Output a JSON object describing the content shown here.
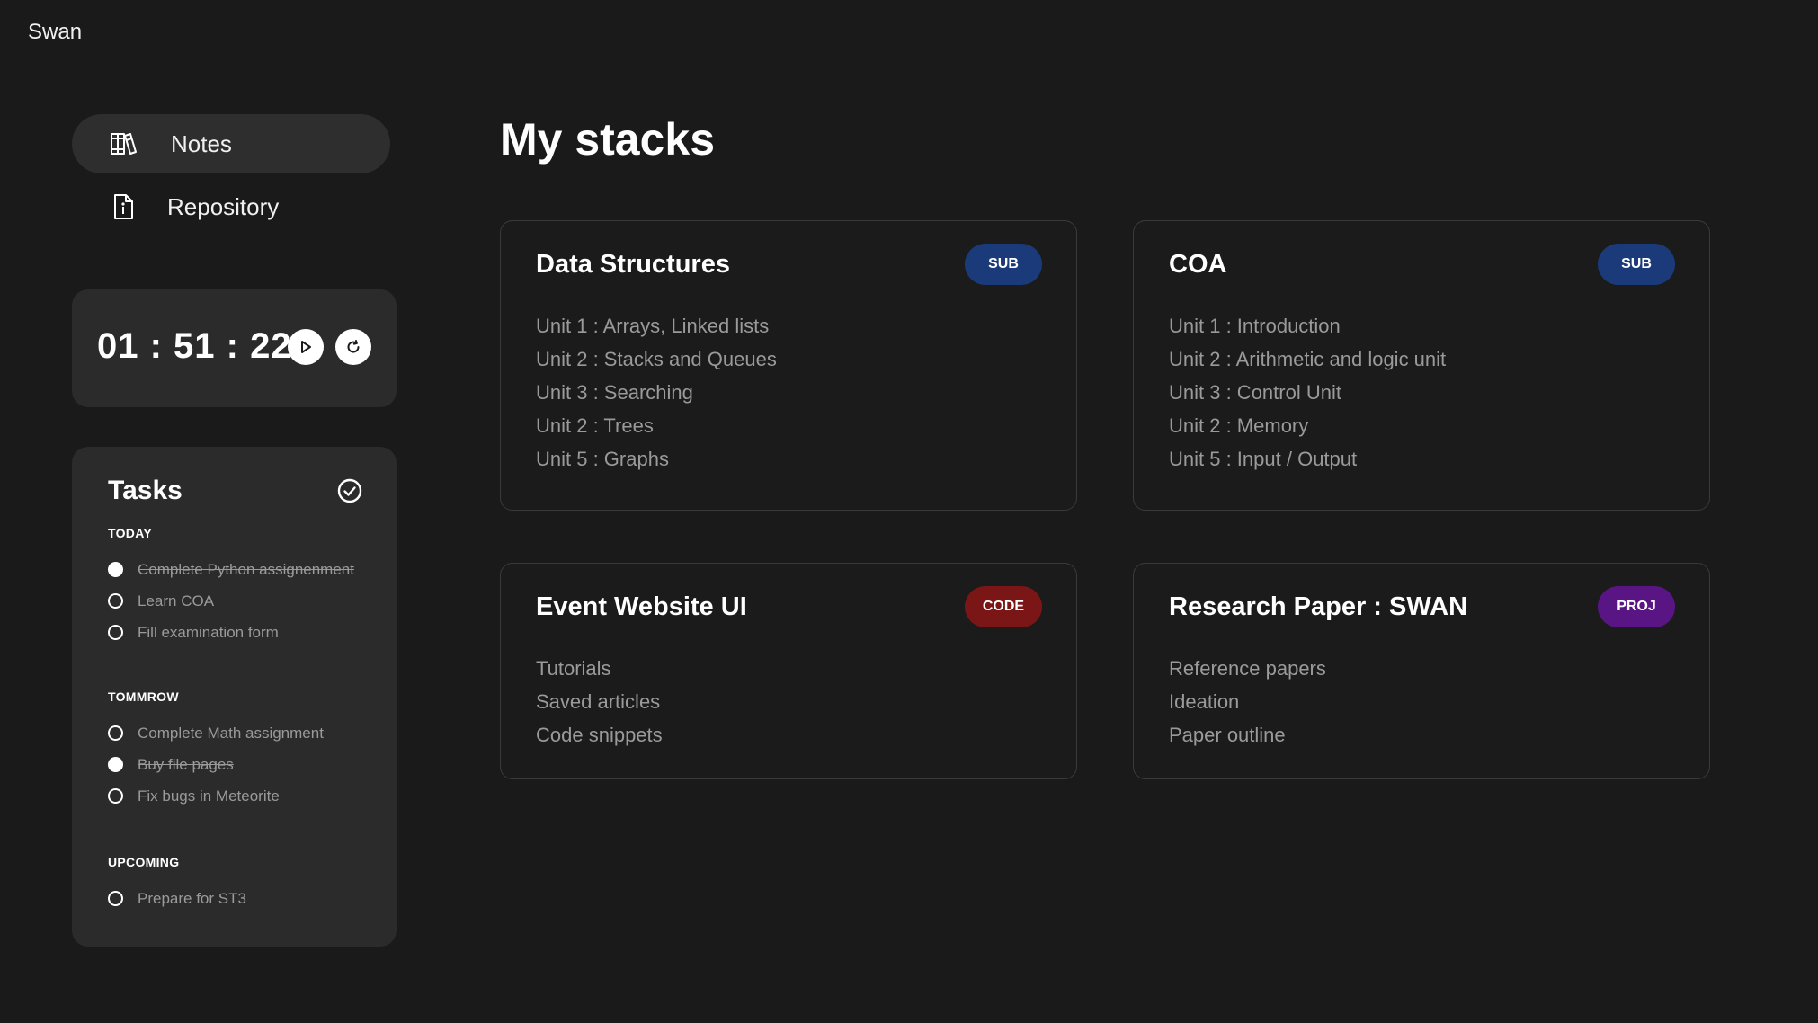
{
  "app": {
    "brand": "Swan"
  },
  "sidebar": {
    "items": [
      {
        "label": "Notes",
        "icon": "books-icon",
        "active": true
      },
      {
        "label": "Repository",
        "icon": "file-icon",
        "active": false
      }
    ]
  },
  "timer": {
    "display": "01 : 51 : 22"
  },
  "tasks": {
    "title": "Tasks",
    "sections": [
      {
        "label": "TODAY",
        "items": [
          {
            "text": "Complete Python assignenment",
            "done": true
          },
          {
            "text": "Learn COA",
            "done": false
          },
          {
            "text": "Fill examination form",
            "done": false
          }
        ]
      },
      {
        "label": "TOMMROW",
        "items": [
          {
            "text": "Complete Math assignment",
            "done": false
          },
          {
            "text": "Buy file pages",
            "done": true
          },
          {
            "text": "Fix bugs in Meteorite",
            "done": false
          }
        ]
      },
      {
        "label": "UPCOMING",
        "items": [
          {
            "text": "Prepare for ST3",
            "done": false
          }
        ]
      }
    ]
  },
  "main": {
    "title": "My stacks",
    "cards": [
      {
        "title": "Data Structures",
        "badge": "SUB",
        "badge_color": "#1b3a7a",
        "items": [
          "Unit 1 : Arrays, Linked lists",
          "Unit 2 : Stacks and Queues",
          "Unit 3 : Searching",
          "Unit 2 : Trees",
          "Unit 5 : Graphs"
        ]
      },
      {
        "title": "COA",
        "badge": "SUB",
        "badge_color": "#1b3a7a",
        "items": [
          "Unit 1 : Introduction",
          "Unit 2 : Arithmetic and logic unit",
          "Unit 3 : Control Unit",
          "Unit 2 : Memory",
          "Unit 5 : Input / Output"
        ]
      },
      {
        "title": "Event Website UI",
        "badge": "CODE",
        "badge_color": "#7a1616",
        "items": [
          "Tutorials",
          "Saved articles",
          "Code snippets"
        ]
      },
      {
        "title": "Research Paper : SWAN",
        "badge": "PROJ",
        "badge_color": "#5a1585",
        "items": [
          "Reference papers",
          "Ideation",
          "Paper outline"
        ]
      }
    ]
  }
}
